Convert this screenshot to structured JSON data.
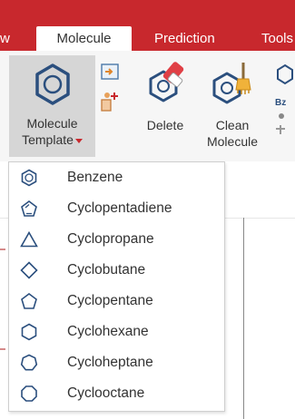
{
  "tabs": [
    {
      "label": "w"
    },
    {
      "label": "Molecule"
    },
    {
      "label": "Prediction"
    },
    {
      "label": "Tools"
    }
  ],
  "ribbon": {
    "template_button": {
      "line1": "Molecule",
      "line2": "Template"
    },
    "delete_button": {
      "label": "Delete"
    },
    "clean_button": {
      "line1": "Clean",
      "line2": "Molecule"
    }
  },
  "templates": [
    {
      "label": "Benzene",
      "icon": "benzene-icon"
    },
    {
      "label": "Cyclopentadiene",
      "icon": "cyclopentadiene-icon"
    },
    {
      "label": "Cyclopropane",
      "icon": "cyclopropane-icon"
    },
    {
      "label": "Cyclobutane",
      "icon": "cyclobutane-icon"
    },
    {
      "label": "Cyclopentane",
      "icon": "cyclopentane-icon"
    },
    {
      "label": "Cyclohexane",
      "icon": "cyclohexane-icon"
    },
    {
      "label": "Cycloheptane",
      "icon": "cycloheptane-icon"
    },
    {
      "label": "Cyclooctane",
      "icon": "cyclooctane-icon"
    }
  ],
  "colors": {
    "accent": "#c8282d",
    "icon_blue": "#2b4f7e",
    "ribbon_bg": "#f6f6f6"
  }
}
